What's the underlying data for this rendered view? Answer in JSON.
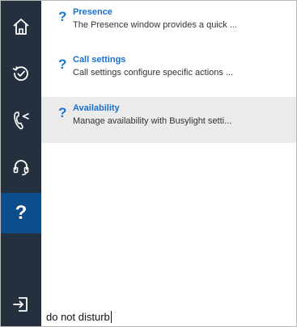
{
  "sidebar": {
    "items": [
      {
        "icon": "home-icon",
        "active": false
      },
      {
        "icon": "history-icon",
        "active": false
      },
      {
        "icon": "call-settings-icon",
        "active": false
      },
      {
        "icon": "headset-icon",
        "active": false
      },
      {
        "icon": "help-icon",
        "label": "?",
        "active": true
      },
      {
        "icon": "sign-out-icon",
        "active": false
      }
    ],
    "colors": {
      "background": "#24303e",
      "active": "#0e4d8b",
      "icon": "#ffffff"
    }
  },
  "results": [
    {
      "icon_label": "?",
      "title": "Presence",
      "description": "The Presence window provides a quick ...",
      "highlighted": false
    },
    {
      "icon_label": "?",
      "title": "Call settings",
      "description": "Call settings configure specific actions ...",
      "highlighted": false
    },
    {
      "icon_label": "?",
      "title": "Availability",
      "description": "Manage availability with Busylight setti...",
      "highlighted": true
    }
  ],
  "search": {
    "value": "do not disturb"
  },
  "colors": {
    "title": "#1a6fce",
    "highlight": "#ebebeb"
  }
}
